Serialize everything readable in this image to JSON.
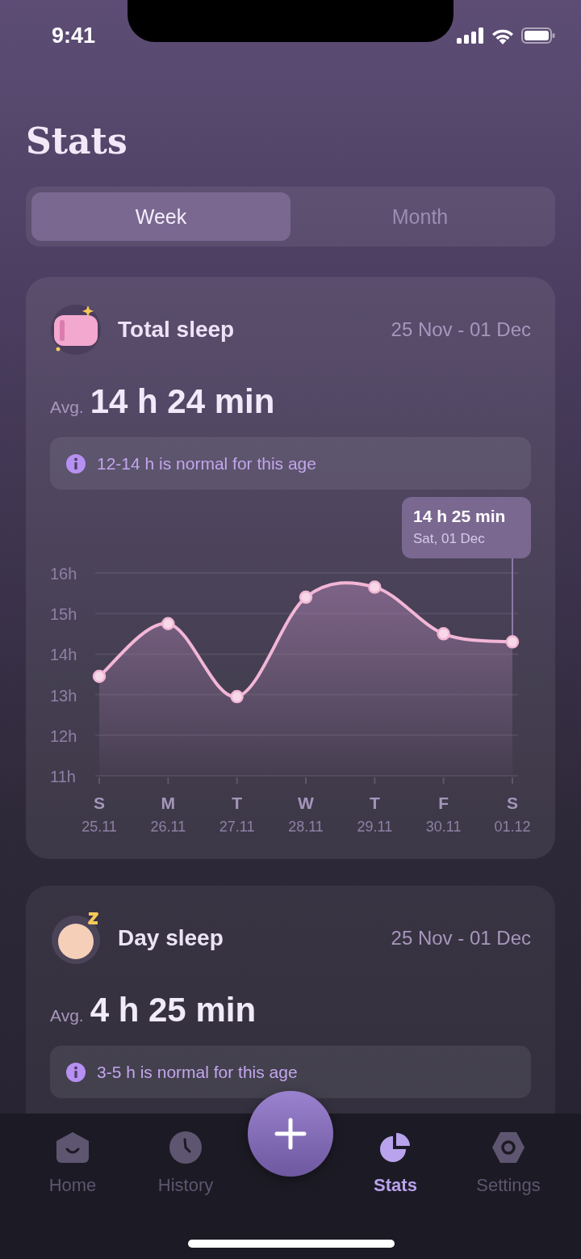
{
  "status_bar": {
    "time": "9:41"
  },
  "title": "Stats",
  "tabs": [
    {
      "label": "Week",
      "selected": true
    },
    {
      "label": "Month",
      "selected": false
    }
  ],
  "cards": [
    {
      "kind": "pillow",
      "title": "Total sleep",
      "date_range": "25 Nov - 01 Dec",
      "avg_label": "Avg.",
      "avg_value": "14 h 24 min",
      "note": "12-14 h is normal for this age",
      "weekdays": [
        "S",
        "M",
        "T",
        "W",
        "T",
        "F",
        "S"
      ],
      "chart_data": {
        "type": "area",
        "categories": [
          "25.11",
          "26.11",
          "27.11",
          "28.11",
          "29.11",
          "30.11",
          "01.12"
        ],
        "series": [
          {
            "color": "#f2b6d6",
            "values": [
              13.45,
              14.75,
              12.95,
              15.4,
              15.65,
              14.5,
              14.3
            ]
          }
        ],
        "grid": true,
        "ylim": [
          11,
          16
        ],
        "yticks": [
          {
            "value": 11,
            "label": "11h"
          },
          {
            "value": 12,
            "label": "12h"
          },
          {
            "value": 13,
            "label": "13h"
          },
          {
            "value": 14,
            "label": "14h"
          },
          {
            "value": 15,
            "label": "15h"
          },
          {
            "value": 16,
            "label": "16h"
          }
        ],
        "ref_lines": [
          {
            "axis": "x",
            "value": "01.12"
          }
        ],
        "annotations": [
          "14 h 25 min",
          "Sat, 01 Dec"
        ]
      }
    },
    {
      "kind": "baby",
      "title": "Day sleep",
      "date_range": "25 Nov - 01 Dec",
      "avg_label": "Avg.",
      "avg_value": "4 h 25 min",
      "note": "3-5 h is normal for this age"
    }
  ],
  "nav": [
    {
      "kind": "home",
      "label": "Home",
      "selected": false
    },
    {
      "kind": "history",
      "label": "History",
      "selected": false
    },
    {
      "kind": "stats",
      "label": "Stats",
      "selected": true
    },
    {
      "kind": "settings",
      "label": "Settings",
      "selected": false
    }
  ]
}
